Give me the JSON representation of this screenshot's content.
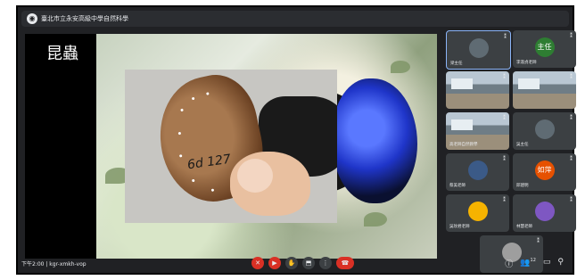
{
  "meeting": {
    "title": "臺北市立永安高級中學自然科學",
    "time_code": "下午2:00 | kgr-xmkh-vop"
  },
  "slide": {
    "title": "昆蟲",
    "specimen_label": "6d 127"
  },
  "participants": [
    {
      "name": "梁主任",
      "type": "camera"
    },
    {
      "name": "李淑貞老師",
      "type": "avatar",
      "initials": "主任",
      "color": "#2e7d32"
    },
    {
      "name": "",
      "type": "classroom"
    },
    {
      "name": "",
      "type": "classroom"
    },
    {
      "name": "高老師自然教學",
      "type": "classroom"
    },
    {
      "name": "吳主任",
      "type": "camera"
    },
    {
      "name": "蔡美老師",
      "type": "avatar",
      "initials": "",
      "color": "#3b5a87"
    },
    {
      "name": "邱建明",
      "type": "avatar",
      "initials": "如萍",
      "color": "#e65100"
    },
    {
      "name": "吳玟君老師",
      "type": "avatar",
      "initials": "",
      "color": "#f6b300"
    },
    {
      "name": "林慧老師",
      "type": "avatar",
      "initials": "",
      "color": "#7e57c2"
    },
    {
      "name": "",
      "type": "avatar",
      "initials": "",
      "color": "#9e9e9e"
    }
  ],
  "controls": [
    {
      "icon": "mic-off-icon",
      "glyph": "✕"
    },
    {
      "icon": "camera-off-icon",
      "glyph": "▶"
    },
    {
      "icon": "hand-icon",
      "glyph": "✋"
    },
    {
      "icon": "present-icon",
      "glyph": "⬒"
    },
    {
      "icon": "more-icon",
      "glyph": "⋮"
    },
    {
      "icon": "hangup-icon",
      "glyph": "☎"
    }
  ],
  "right_icons": [
    "info-icon",
    "people-icon",
    "chat-icon",
    "activities-icon"
  ],
  "people_count": "12",
  "colors": {
    "bg": "#202124",
    "tile": "#3c4043",
    "danger": "#d93025"
  }
}
